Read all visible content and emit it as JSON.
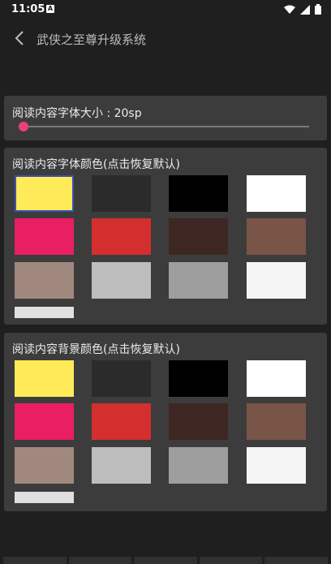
{
  "status_bar": {
    "time": "11:05",
    "badge": "A",
    "icons": [
      "wifi-icon",
      "signal-icon",
      "battery-icon"
    ]
  },
  "toolbar": {
    "title": "武侠之至尊升级系统",
    "back_icon": "chevron-left-icon"
  },
  "font_size_card": {
    "label": "阅读内容字体大小 : 20sp",
    "slider_value_fraction": 0.0,
    "accent": "#ec407a"
  },
  "font_color_card": {
    "title": "阅读内容字体颜色(点击恢复默认)",
    "selected_index": 0,
    "colors": [
      "#ffeb58",
      "#2b2b2b",
      "#000000",
      "#ffffff",
      "#e91e63",
      "#d32f2f",
      "#3e2723",
      "#795548",
      "#a1887f",
      "#bdbdbd",
      "#9e9e9e",
      "#f5f5f5",
      "#e0e0e0"
    ]
  },
  "bg_color_card": {
    "title": "阅读内容背景颜色(点击恢复默认)",
    "selected_index": -1,
    "colors": [
      "#ffeb58",
      "#2b2b2b",
      "#000000",
      "#ffffff",
      "#e91e63",
      "#d32f2f",
      "#3e2723",
      "#795548",
      "#a1887f",
      "#bdbdbd",
      "#9e9e9e",
      "#f5f5f5",
      "#e0e0e0"
    ]
  }
}
